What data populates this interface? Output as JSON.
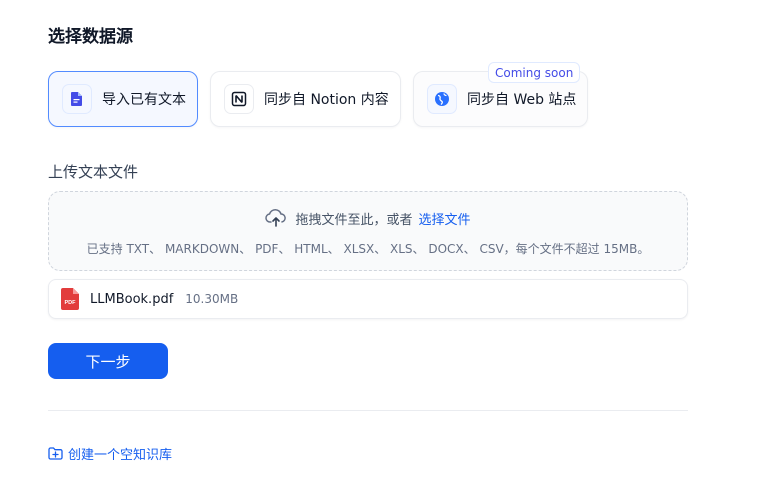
{
  "page": {
    "title": "选择数据源"
  },
  "sources": [
    {
      "label": "导入已有文本",
      "icon": "file-text-icon",
      "selected": true
    },
    {
      "label": "同步自 Notion 内容",
      "icon": "notion-icon",
      "selected": false
    },
    {
      "label": "同步自 Web 站点",
      "icon": "globe-icon",
      "selected": false,
      "badge": "Coming soon"
    }
  ],
  "upload": {
    "label": "上传文本文件",
    "drop_text": "拖拽文件至此，或者",
    "browse_link": "选择文件",
    "supported_formats": "已支持 TXT、 MARKDOWN、 PDF、 HTML、 XLSX、 XLS、 DOCX、 CSV，每个文件不超过 15MB。"
  },
  "files": [
    {
      "badge": "PDF",
      "name": "LLMBook.pdf",
      "size": "10.30MB"
    }
  ],
  "actions": {
    "next_label": "下一步",
    "create_empty_label": "创建一个空知识库"
  },
  "colors": {
    "accent": "#155eef",
    "selected_border": "#528bff",
    "pdf_red": "#e23c3c"
  }
}
